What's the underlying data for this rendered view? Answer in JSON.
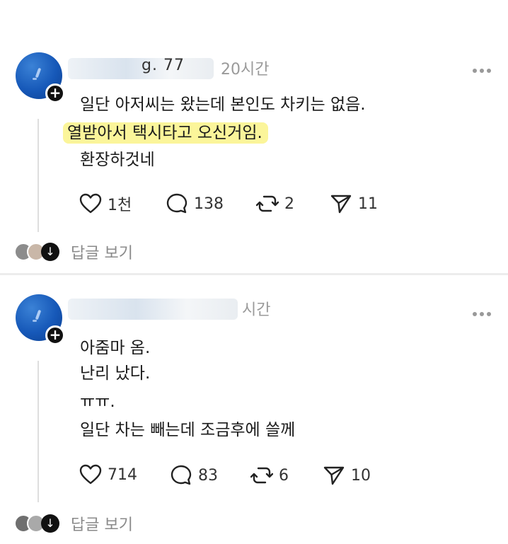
{
  "posts": [
    {
      "username_visible_fragment": "g.  77",
      "time": "20시간",
      "lines": [
        "일단 아저씨는 왔는데 본인도 차키는 없음.",
        "열받아서 택시타고 오신거임.",
        "환장하것네"
      ],
      "likes": "1천",
      "comments": "138",
      "reposts": "2",
      "shares": "11",
      "view_replies": "답글 보기"
    },
    {
      "username_visible_fragment": "",
      "time": "시간",
      "lines": [
        "아줌마 옴.",
        "난리 났다.",
        "ㅠㅠ.",
        "일단 차는 빼는데 조금후에 쓸께"
      ],
      "likes": "714",
      "comments": "83",
      "reposts": "6",
      "shares": "10",
      "view_replies": "답글 보기"
    }
  ],
  "colors": {
    "avatar": "#1658b8",
    "highlight": "#fbf59a",
    "meta_text": "#9a9a9a"
  }
}
